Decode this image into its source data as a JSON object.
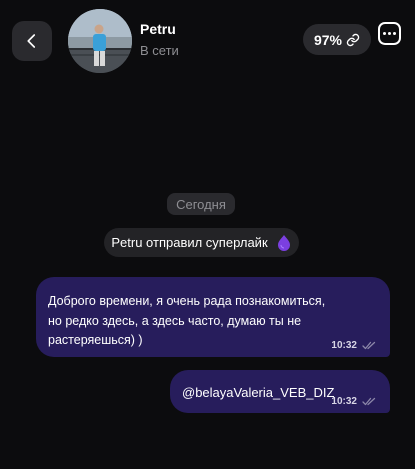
{
  "header": {
    "back_icon": "chevron-left-icon",
    "contact_name": "Petru",
    "contact_status": "В сети",
    "match_percent": "97%",
    "match_icon": "link-icon",
    "more_icon": "more-horizontal-icon"
  },
  "chat": {
    "date_label": "Сегодня",
    "superlike_text": "Petru отправил суперлайк",
    "superlike_icon": "purple-drop-icon",
    "messages": [
      {
        "text": "Доброго времени, я очень рада познакомиться,\nно редко здесь, а здесь часто, думаю ты не\nрастеряешься) )",
        "time": "10:32",
        "status_icon": "double-check-icon"
      },
      {
        "text": "@belayaValeria_VEB_DIZ",
        "time": "10:32",
        "status_icon": "double-check-icon"
      }
    ]
  },
  "colors": {
    "background": "#0c0c0e",
    "bubble": "#271d5c",
    "chip": "#2a2a2e",
    "accent_drop": "#7b3fe0"
  }
}
